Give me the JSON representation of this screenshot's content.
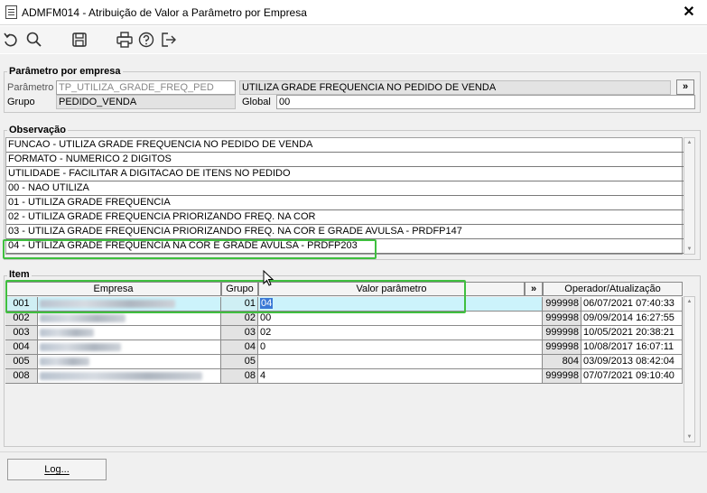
{
  "window": {
    "title": "ADMFM014 - Atribuição de Valor a Parâmetro por Empresa",
    "close_glyph": "✕"
  },
  "toolbar": {
    "icons": [
      "undo-icon",
      "search-icon",
      "save-icon",
      "print-icon",
      "help-icon",
      "exit-icon"
    ]
  },
  "parametro_section": {
    "label": "Parâmetro por empresa",
    "parametro_label": "Parâmetro",
    "parametro_value": "TP_UTILIZA_GRADE_FREQ_PED",
    "descricao_value": "UTILIZA GRADE FREQUENCIA NO PEDIDO DE VENDA",
    "more_label": "»",
    "grupo_label": "Grupo",
    "grupo_value": "PEDIDO_VENDA",
    "global_label": "Global",
    "global_value": "00"
  },
  "observacao": {
    "label": "Observação",
    "lines": [
      "FUNCAO - UTILIZA GRADE FREQUENCIA NO PEDIDO DE VENDA",
      "FORMATO - NUMERICO 2 DIGITOS",
      "UTILIDADE - FACILITAR A DIGITACAO DE ITENS NO PEDIDO",
      "00 - NAO UTILIZA",
      "01 - UTILIZA GRADE FREQUENCIA",
      "02 - UTILIZA GRADE FREQUENCIA PRIORIZANDO FREQ. NA COR",
      "03 - UTILIZA GRADE FREQUENCIA PRIORIZANDO FREQ. NA COR E GRADE AVULSA - PRDFP147",
      "04 - UTILIZA GRADE FREQUENCIA NA COR E GRADE AVULSA  - PRDFP203"
    ]
  },
  "item": {
    "label": "Item",
    "headers": {
      "empresa": "Empresa",
      "grupo": "Grupo",
      "valor": "Valor parâmetro",
      "more": "»",
      "operador": "Operador/Atualização"
    },
    "rows": [
      {
        "code": "001",
        "grupo": "01",
        "valor": "04",
        "operador": "999998",
        "data": "06/07/2021 07:40:33"
      },
      {
        "code": "002",
        "grupo": "02",
        "valor": "00",
        "operador": "999998",
        "data": "09/09/2014 16:27:55"
      },
      {
        "code": "003",
        "grupo": "03",
        "valor": "02",
        "operador": "999998",
        "data": "10/05/2021 20:38:21"
      },
      {
        "code": "004",
        "grupo": "04",
        "valor": "0",
        "operador": "999998",
        "data": "10/08/2017 16:07:11"
      },
      {
        "code": "005",
        "grupo": "05",
        "valor": "",
        "operador": "804",
        "data": "03/09/2013 08:42:04"
      },
      {
        "code": "008",
        "grupo": "08",
        "valor": "4",
        "operador": "999998",
        "data": "07/07/2021 09:10:40"
      }
    ]
  },
  "footer": {
    "log_label": "Log..."
  }
}
